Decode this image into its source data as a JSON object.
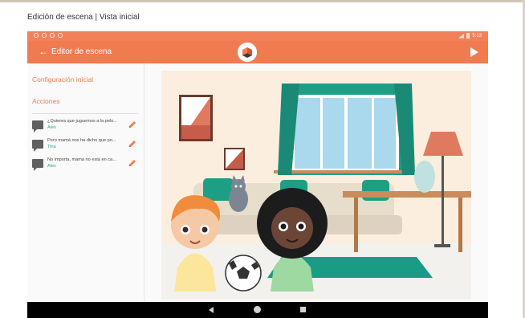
{
  "window": {
    "title": "Edición de escena | Vista inicial"
  },
  "appbar": {
    "title": "Editor de escena",
    "back_icon": "arrow-left-icon",
    "play_icon": "play-icon"
  },
  "status": {
    "time": "5:13"
  },
  "sidebar": {
    "section_initial": "Configuración inicial",
    "section_actions": "Acciones",
    "actions": [
      {
        "text": "¿Quieres que juguemos a la pelo...",
        "character": "Alex"
      },
      {
        "text": "Pero mamá nos ha dicho que po...",
        "character": "Tina"
      },
      {
        "text": "No importa, mamá no está en ca...",
        "character": "Alex"
      }
    ],
    "add_label": "+"
  },
  "colors": {
    "accent": "#f07b51",
    "teal": "#1f9e86",
    "character_name": "#26a69a"
  }
}
